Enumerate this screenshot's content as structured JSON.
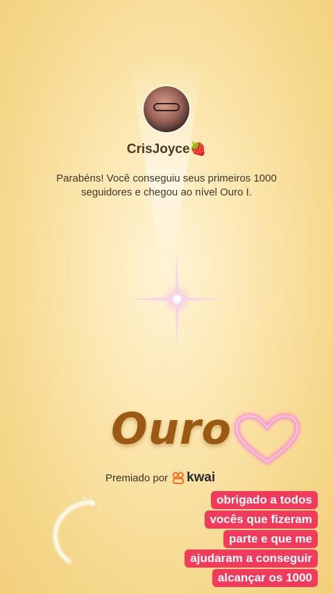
{
  "profile": {
    "username": "CrisJoyce",
    "username_emoji": "🍓",
    "avatar_icon": "avatar-photo"
  },
  "message": "Parabéns! Você conseguiu seus primeiros 1000 seguidores e chegou ao nível Ouro I.",
  "level": {
    "name": "Ouro"
  },
  "award": {
    "label": "Premiado por",
    "brand": "kwai",
    "brand_icon": "kwai-logo-icon",
    "brand_color": "#ff6a1f"
  },
  "caption": {
    "lines": [
      "obrigado a todos",
      "vocês que fizeram",
      "parte e que me",
      "ajudaram a conseguir",
      "alcançar os 1000"
    ],
    "background": "#f23a5c"
  },
  "decorations": {
    "sparkle_icon": "sparkle-icon",
    "heart_icon": "glowing-heart-icon",
    "swirl_icon": "swirl-icon"
  }
}
